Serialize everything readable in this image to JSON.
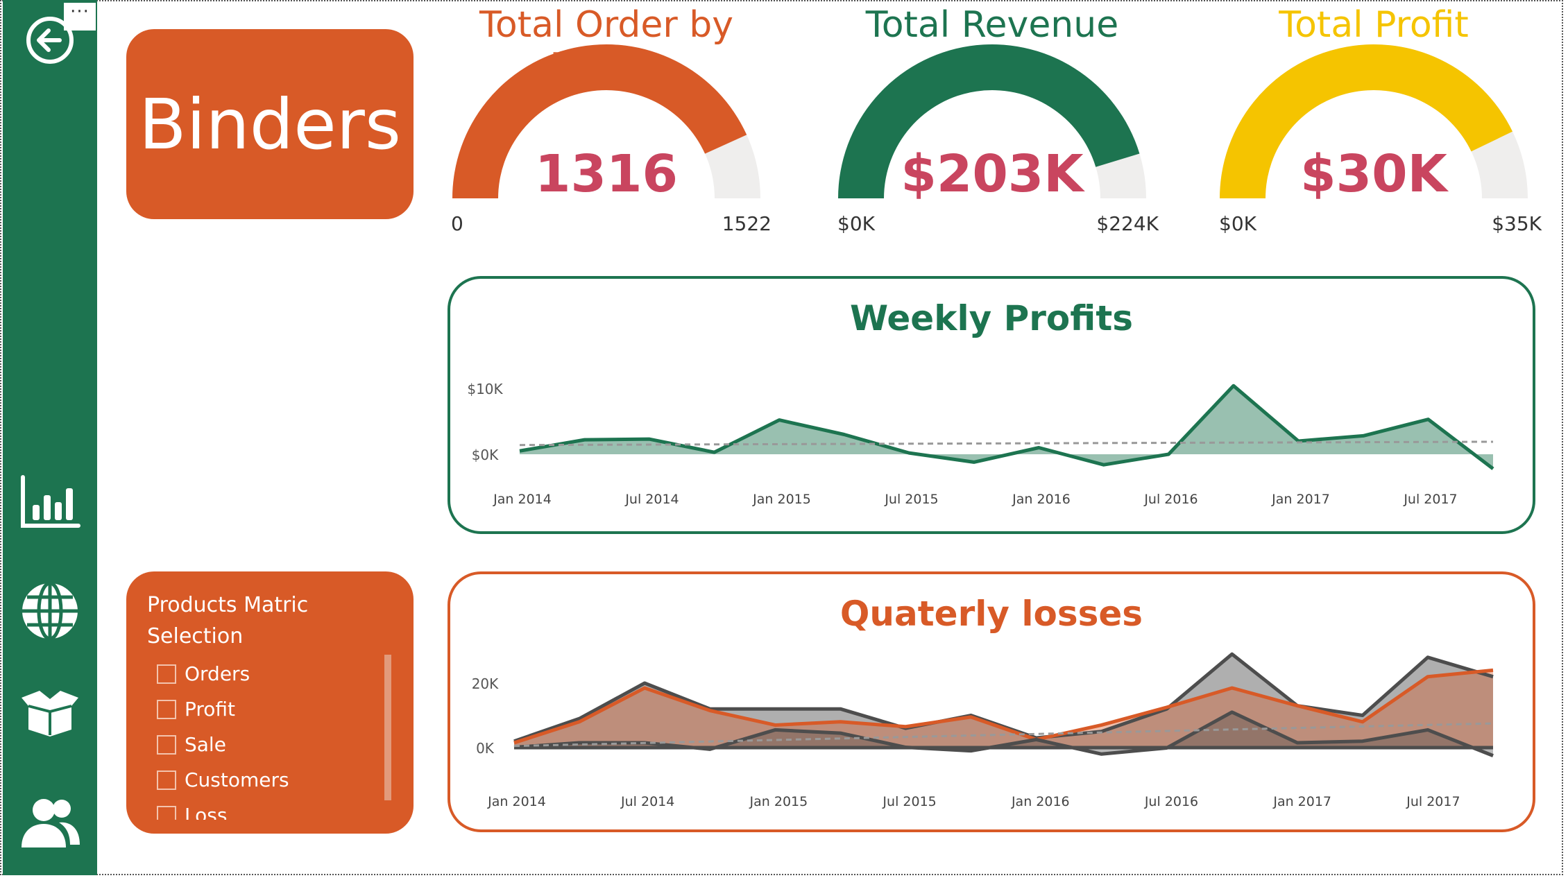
{
  "sidebar": {
    "more_label": "···",
    "buttons": [
      {
        "icon": "back-arrow-icon"
      },
      {
        "icon": "bar-chart-icon"
      },
      {
        "icon": "globe-icon"
      },
      {
        "icon": "box-icon"
      },
      {
        "icon": "people-icon"
      }
    ],
    "color": "#1d7450"
  },
  "category": {
    "label": "Binders",
    "color": "#d85a27"
  },
  "gauges": [
    {
      "title": "Total Order by Month",
      "value_label": "1316",
      "min_label": "0",
      "max_label": "1522",
      "value": 1316,
      "max": 1522,
      "color": "#d85a27"
    },
    {
      "title": "Total Revenue",
      "value_label": "$203K",
      "min_label": "$0K",
      "max_label": "$224K",
      "value": 203,
      "max": 224,
      "color": "#1d7450"
    },
    {
      "title": "Total Profit",
      "value_label": "$30K",
      "min_label": "$0K",
      "max_label": "$35K",
      "value": 30,
      "max": 35,
      "color": "#f5c400"
    }
  ],
  "slicer": {
    "title": "Products Matric Selection",
    "items": [
      "Orders",
      "Profit",
      "Sale",
      "Customers",
      "Loss"
    ]
  },
  "chart_data": [
    {
      "type": "area",
      "title": "Weekly Profits",
      "color": "#1d7450",
      "x_ticks": [
        "Jan 2014",
        "Jul 2014",
        "Jan 2015",
        "Jul 2015",
        "Jan 2016",
        "Jul 2016",
        "Jan 2017",
        "Jul 2017"
      ],
      "y_ticks": [
        "$0K",
        "$10K"
      ],
      "ylim": [
        -2000,
        12000
      ],
      "x": [
        0,
        1,
        2,
        3,
        4,
        5,
        6,
        7,
        8,
        9,
        10,
        11,
        12,
        13,
        14,
        15
      ],
      "series": [
        {
          "values": [
            500,
            2200,
            2300,
            300,
            5200,
            3000,
            200,
            -1200,
            1000,
            -1600,
            0,
            10400,
            2000,
            2800,
            5300,
            -2200
          ]
        }
      ],
      "trend": [
        1400,
        1900
      ]
    },
    {
      "type": "area",
      "title": "Quaterly losses",
      "color": "#d85a27",
      "x_ticks": [
        "Jan 2014",
        "Jul 2014",
        "Jan 2015",
        "Jul 2015",
        "Jan 2016",
        "Jul 2016",
        "Jan 2017",
        "Jul 2017"
      ],
      "y_ticks": [
        "0K",
        "20K"
      ],
      "ylim": [
        -3000,
        30000
      ],
      "x": [
        0,
        1,
        2,
        3,
        4,
        5,
        6,
        7,
        8,
        9,
        10,
        11,
        12,
        13,
        14,
        15
      ],
      "series": [
        {
          "values": [
            2000,
            9000,
            20000,
            12000,
            12000,
            12000,
            6000,
            10000,
            3000,
            5000,
            12000,
            29000,
            13000,
            10000,
            28000,
            22000
          ],
          "color": "#4d4d4d"
        },
        {
          "values": [
            1500,
            8000,
            18500,
            11500,
            7000,
            8000,
            6500,
            9500,
            2500,
            7000,
            12500,
            18500,
            13000,
            8000,
            22000,
            24000
          ],
          "color": "#d85a27"
        },
        {
          "values": [
            100,
            1500,
            1500,
            -500,
            5500,
            4500,
            100,
            -1000,
            2500,
            -2000,
            -100,
            11000,
            1500,
            2000,
            5500,
            -2500
          ],
          "color": "#4d4d4d"
        },
        {
          "values": [
            0,
            0,
            0,
            0,
            0,
            0,
            0,
            0,
            0,
            0,
            0,
            0,
            0,
            0,
            0,
            0
          ],
          "color": "#4d4d4d"
        }
      ],
      "trend": [
        500,
        7500
      ]
    }
  ]
}
